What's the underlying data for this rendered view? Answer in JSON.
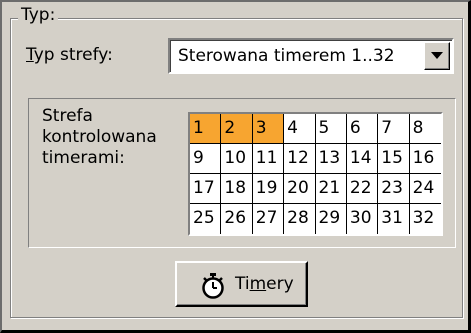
{
  "group": {
    "title": "Typ:"
  },
  "zone_type": {
    "label_first": "T",
    "label_rest": "yp strefy:",
    "selected": "Sterowana timerem 1..32"
  },
  "zone_label": "Strefa kontrolowana timerami:",
  "zones": [
    {
      "n": "1",
      "selected": true
    },
    {
      "n": "2",
      "selected": true
    },
    {
      "n": "3",
      "selected": true
    },
    {
      "n": "4",
      "selected": false
    },
    {
      "n": "5",
      "selected": false
    },
    {
      "n": "6",
      "selected": false
    },
    {
      "n": "7",
      "selected": false
    },
    {
      "n": "8",
      "selected": false
    },
    {
      "n": "9",
      "selected": false
    },
    {
      "n": "10",
      "selected": false
    },
    {
      "n": "11",
      "selected": false
    },
    {
      "n": "12",
      "selected": false
    },
    {
      "n": "13",
      "selected": false
    },
    {
      "n": "14",
      "selected": false
    },
    {
      "n": "15",
      "selected": false
    },
    {
      "n": "16",
      "selected": false
    },
    {
      "n": "17",
      "selected": false
    },
    {
      "n": "18",
      "selected": false
    },
    {
      "n": "19",
      "selected": false
    },
    {
      "n": "20",
      "selected": false
    },
    {
      "n": "21",
      "selected": false
    },
    {
      "n": "22",
      "selected": false
    },
    {
      "n": "23",
      "selected": false
    },
    {
      "n": "24",
      "selected": false
    },
    {
      "n": "25",
      "selected": false
    },
    {
      "n": "26",
      "selected": false
    },
    {
      "n": "27",
      "selected": false
    },
    {
      "n": "28",
      "selected": false
    },
    {
      "n": "29",
      "selected": false
    },
    {
      "n": "30",
      "selected": false
    },
    {
      "n": "31",
      "selected": false
    },
    {
      "n": "32",
      "selected": false
    }
  ],
  "colors": {
    "selected_zone": "#f7a530"
  },
  "timers_button": {
    "label_pre": "Ti",
    "label_ul": "m",
    "label_post": "ery",
    "icon": "stopwatch-icon"
  }
}
